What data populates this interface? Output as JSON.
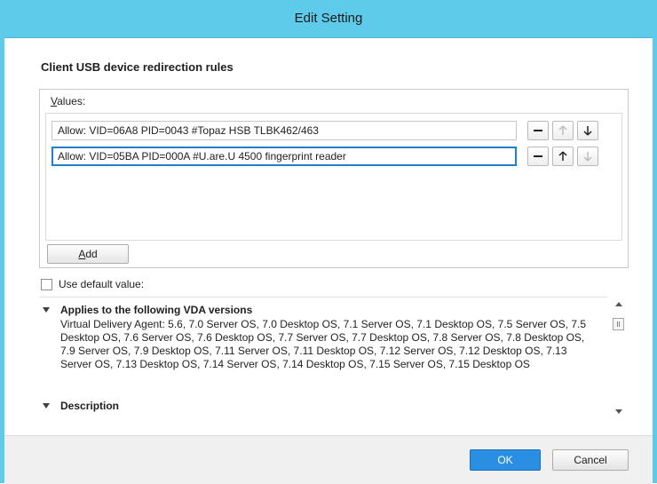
{
  "window": {
    "title": "Edit Setting"
  },
  "section": {
    "title": "Client USB device redirection rules"
  },
  "values": {
    "label_accel": "V",
    "label_rest": "alues:",
    "rows": [
      {
        "value": "Allow: VID=06A8 PID=0043 #Topaz HSB TLBK462/463",
        "focused": false
      },
      {
        "value": "Allow: VID=05BA PID=000A #U.are.U 4500 fingerprint reader",
        "focused": true
      }
    ],
    "add_accel": "A",
    "add_rest": "dd"
  },
  "use_default": {
    "label": "Use default value:",
    "checked": false
  },
  "info": {
    "versions_title": "Applies to the following VDA versions",
    "versions_text": "Virtual Delivery Agent: 5.6, 7.0 Server OS, 7.0 Desktop OS, 7.1 Server OS, 7.1 Desktop OS, 7.5 Server OS, 7.5 Desktop OS, 7.6 Server OS, 7.6 Desktop OS, 7.7 Server OS, 7.7 Desktop OS, 7.8 Server OS, 7.8 Desktop OS, 7.9 Server OS, 7.9 Desktop OS, 7.11 Server OS, 7.11 Desktop OS, 7.12 Server OS, 7.12 Desktop OS, 7.13 Server OS, 7.13 Desktop OS, 7.14 Server OS, 7.14 Desktop OS, 7.15 Server OS, 7.15 Desktop OS",
    "description_title": "Description"
  },
  "footer": {
    "ok_label": "OK",
    "cancel_label": "Cancel"
  },
  "colors": {
    "titlebar": "#5ecbea",
    "primary_button": "#2a8ee2",
    "focus_border": "#1f7fd1"
  },
  "icons": {
    "remove": "minus-icon",
    "move_up": "arrow-up-icon",
    "move_down": "arrow-down-icon",
    "expander": "triangle-down-icon"
  }
}
